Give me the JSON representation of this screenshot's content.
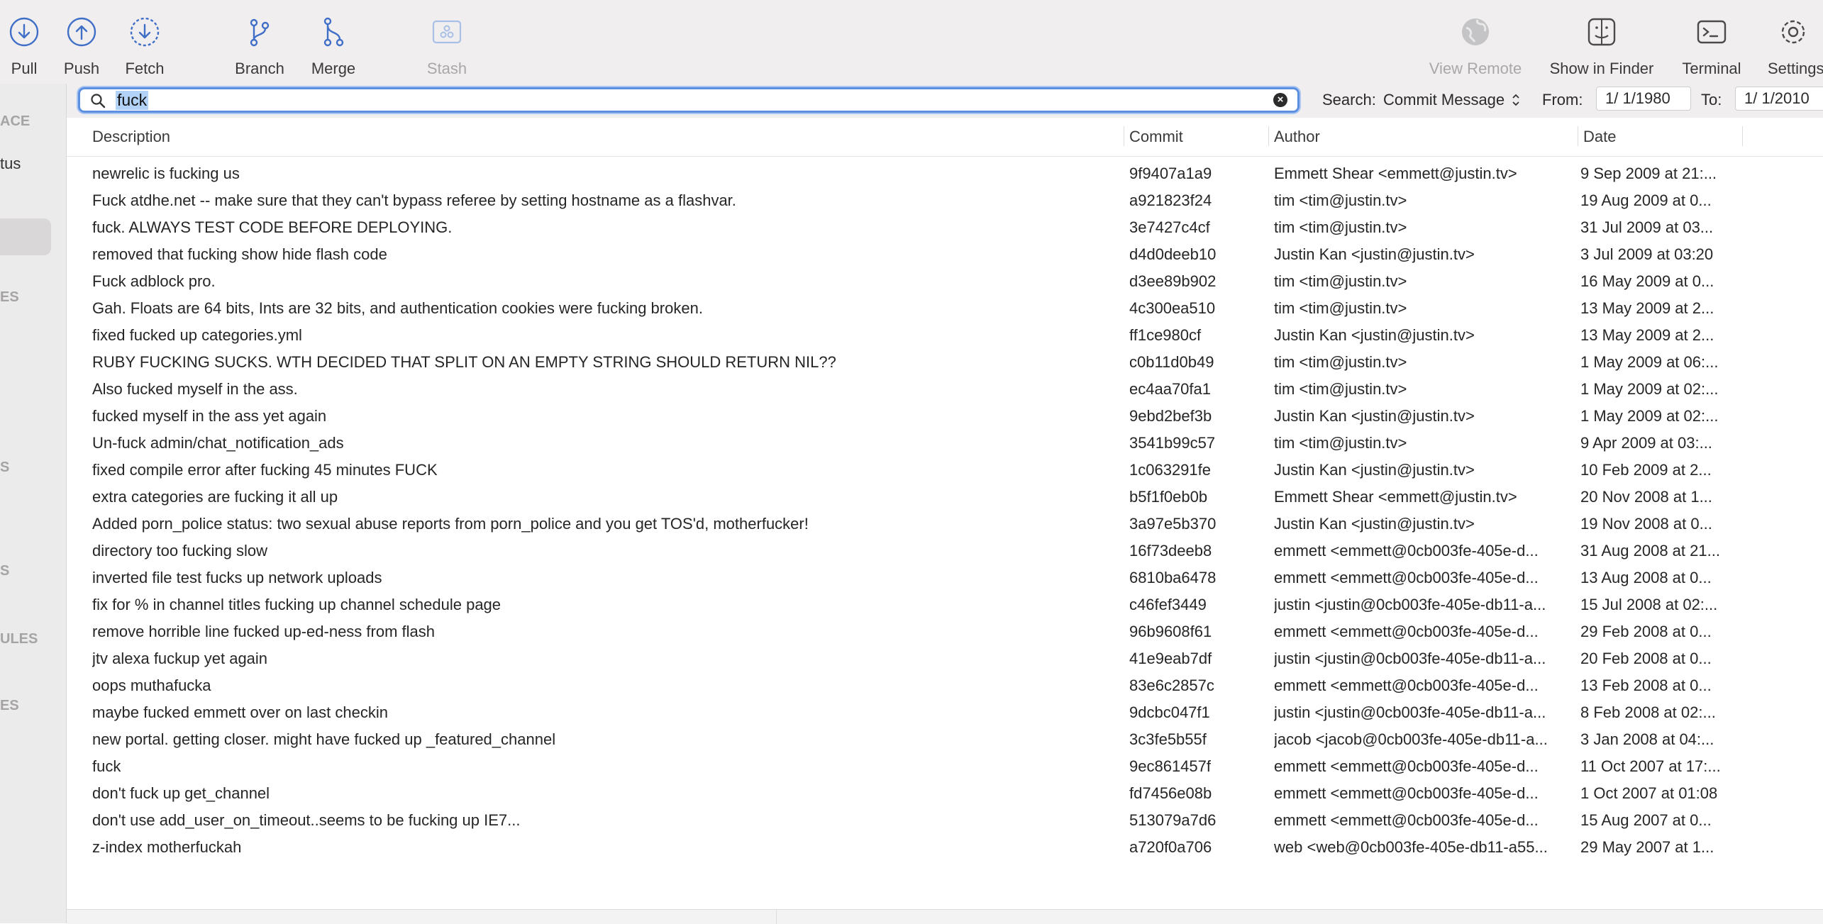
{
  "toolbar": {
    "pull": "Pull",
    "push": "Push",
    "fetch": "Fetch",
    "branch": "Branch",
    "merge": "Merge",
    "stash": "Stash",
    "view_remote": "View Remote",
    "show_in_finder": "Show in Finder",
    "terminal": "Terminal",
    "settings": "Settings"
  },
  "sidebar": {
    "labels": [
      "ACE",
      "tus",
      "ES",
      "S",
      "S",
      "ULES",
      "ES"
    ]
  },
  "search": {
    "query": "fuck",
    "search_label": "Search:",
    "search_mode": "Commit Message",
    "from_label": "From:",
    "from_value": "1/  1/1980",
    "to_label": "To:",
    "to_value": "1/  1/2010"
  },
  "table": {
    "headers": {
      "description": "Description",
      "commit": "Commit",
      "author": "Author",
      "date": "Date"
    },
    "rows": [
      {
        "desc": "newrelic is fucking us",
        "commit": "9f9407a1a9",
        "author": "Emmett Shear <emmett@justin.tv>",
        "date": "9 Sep 2009 at 21:..."
      },
      {
        "desc": "Fuck atdhe.net -- make sure that they can't bypass referee by setting hostname as a flashvar.",
        "commit": "a921823f24",
        "author": "tim <tim@justin.tv>",
        "date": "19 Aug 2009 at 0..."
      },
      {
        "desc": "fuck.  ALWAYS TEST CODE BEFORE DEPLOYING.",
        "commit": "3e7427c4cf",
        "author": "tim <tim@justin.tv>",
        "date": "31 Jul 2009 at 03..."
      },
      {
        "desc": "removed that fucking show hide flash code",
        "commit": "d4d0deeb10",
        "author": "Justin Kan <justin@justin.tv>",
        "date": "3 Jul 2009 at 03:20"
      },
      {
        "desc": "Fuck adblock pro.",
        "commit": "d3ee89b902",
        "author": "tim <tim@justin.tv>",
        "date": "16 May 2009 at 0..."
      },
      {
        "desc": "Gah.  Floats are 64 bits, Ints are 32 bits, and authentication cookies were fucking broken.",
        "commit": "4c300ea510",
        "author": "tim <tim@justin.tv>",
        "date": "13 May 2009 at 2..."
      },
      {
        "desc": "fixed fucked up categories.yml",
        "commit": "ff1ce980cf",
        "author": "Justin Kan <justin@justin.tv>",
        "date": "13 May 2009 at 2..."
      },
      {
        "desc": "RUBY FUCKING SUCKS.  WTH DECIDED THAT SPLIT ON AN EMPTY STRING SHOULD RETURN NIL??",
        "commit": "c0b11d0b49",
        "author": "tim <tim@justin.tv>",
        "date": "1 May 2009 at 06:..."
      },
      {
        "desc": "Also fucked myself in the ass.",
        "commit": "ec4aa70fa1",
        "author": "tim <tim@justin.tv>",
        "date": "1 May 2009 at 02:..."
      },
      {
        "desc": "fucked myself in the ass yet again",
        "commit": "9ebd2bef3b",
        "author": "Justin Kan <justin@justin.tv>",
        "date": "1 May 2009 at 02:..."
      },
      {
        "desc": "Un-fuck admin/chat_notification_ads",
        "commit": "3541b99c57",
        "author": "tim <tim@justin.tv>",
        "date": "9 Apr 2009 at 03:..."
      },
      {
        "desc": "fixed compile error after fucking 45 minutes FUCK",
        "commit": "1c063291fe",
        "author": "Justin Kan <justin@justin.tv>",
        "date": "10 Feb 2009 at 2..."
      },
      {
        "desc": "extra categories are fucking it all up",
        "commit": "b5f1f0eb0b",
        "author": "Emmett Shear <emmett@justin.tv>",
        "date": "20 Nov 2008 at 1..."
      },
      {
        "desc": "Added porn_police status: two sexual abuse reports from porn_police and you get TOS'd, motherfucker!",
        "commit": "3a97e5b370",
        "author": "Justin Kan <justin@justin.tv>",
        "date": "19 Nov 2008 at 0..."
      },
      {
        "desc": "directory too fucking slow",
        "commit": "16f73deeb8",
        "author": "emmett <emmett@0cb003fe-405e-d...",
        "date": "31 Aug 2008 at 21..."
      },
      {
        "desc": "inverted file test fucks up network uploads",
        "commit": "6810ba6478",
        "author": "emmett <emmett@0cb003fe-405e-d...",
        "date": "13 Aug 2008 at 0..."
      },
      {
        "desc": "fix for % in channel titles fucking up channel schedule page",
        "commit": "c46fef3449",
        "author": "justin <justin@0cb003fe-405e-db11-a...",
        "date": "15 Jul 2008 at 02:..."
      },
      {
        "desc": "remove horrible line fucked up-ed-ness from flash",
        "commit": "96b9608f61",
        "author": "emmett <emmett@0cb003fe-405e-d...",
        "date": "29 Feb 2008 at 0..."
      },
      {
        "desc": "jtv alexa fuckup yet again",
        "commit": "41e9eab7df",
        "author": "justin <justin@0cb003fe-405e-db11-a...",
        "date": "20 Feb 2008 at 0..."
      },
      {
        "desc": "oops muthafucka",
        "commit": "83e6c2857c",
        "author": "emmett <emmett@0cb003fe-405e-d...",
        "date": "13 Feb 2008 at 0..."
      },
      {
        "desc": "maybe fucked emmett over on last checkin",
        "commit": "9dcbc047f1",
        "author": "justin <justin@0cb003fe-405e-db11-a...",
        "date": "8 Feb 2008 at 02:..."
      },
      {
        "desc": "new portal. getting closer. might have fucked up _featured_channel",
        "commit": "3c3fe5b55f",
        "author": "jacob <jacob@0cb003fe-405e-db11-a...",
        "date": "3 Jan 2008 at 04:..."
      },
      {
        "desc": "fuck",
        "commit": "9ec861457f",
        "author": "emmett <emmett@0cb003fe-405e-d...",
        "date": "11 Oct 2007 at 17:..."
      },
      {
        "desc": "don't fuck up get_channel",
        "commit": "fd7456e08b",
        "author": "emmett <emmett@0cb003fe-405e-d...",
        "date": "1 Oct 2007 at 01:08"
      },
      {
        "desc": "don't use add_user_on_timeout..seems to be fucking up IE7...",
        "commit": "513079a7d6",
        "author": "emmett <emmett@0cb003fe-405e-d...",
        "date": "15 Aug 2007 at 0..."
      },
      {
        "desc": "z-index motherfuckah",
        "commit": "a720f0a706",
        "author": "web <web@0cb003fe-405e-db11-a55...",
        "date": "29 May 2007 at 1..."
      }
    ]
  }
}
